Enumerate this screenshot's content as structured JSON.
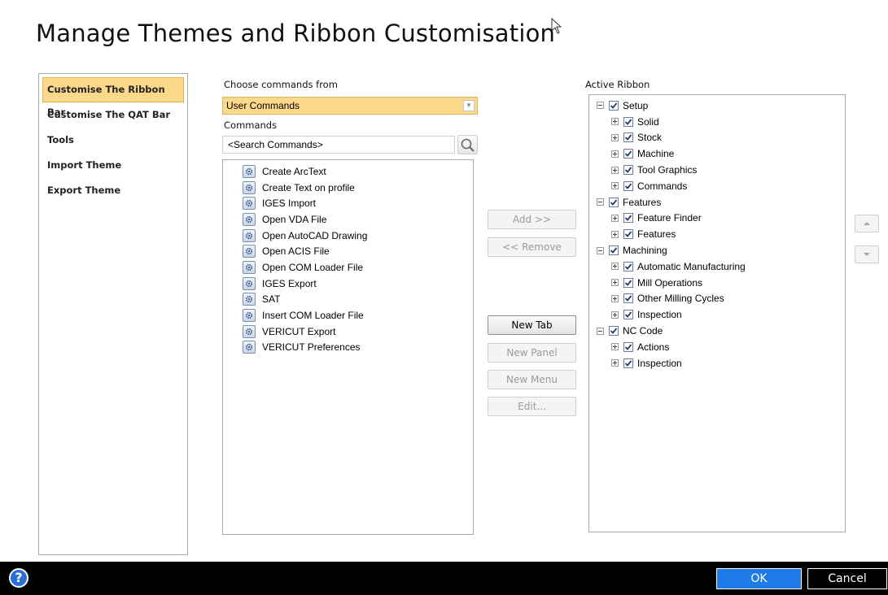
{
  "title": "Manage Themes and Ribbon Customisation",
  "nav": {
    "items": [
      {
        "label": "Customise The Ribbon Bar",
        "active": true
      },
      {
        "label": "Customise The QAT Bar",
        "active": false
      },
      {
        "label": "Tools",
        "active": false
      },
      {
        "label": "Import Theme",
        "active": false
      },
      {
        "label": "Export Theme",
        "active": false
      }
    ]
  },
  "commands_panel": {
    "choose_label": "Choose commands from",
    "selected_source": "User Commands",
    "commands_label": "Commands",
    "search_placeholder": "<Search Commands>",
    "items": [
      "Create ArcText",
      "Create Text on profile",
      "IGES Import",
      "Open VDA File",
      "Open AutoCAD Drawing",
      "Open ACIS File",
      "Open COM Loader File",
      "IGES Export",
      "SAT",
      "Insert COM Loader File",
      "VERICUT Export",
      "VERICUT Preferences"
    ]
  },
  "buttons": {
    "add": "Add >>",
    "remove": "<< Remove",
    "new_tab": "New Tab",
    "new_panel": "New Panel",
    "new_menu": "New Menu",
    "edit": "Edit..."
  },
  "active_ribbon": {
    "label": "Active Ribbon",
    "tree": [
      {
        "label": "Setup",
        "level": 0,
        "expanded": true,
        "checked": true
      },
      {
        "label": "Solid",
        "level": 1,
        "expanded": false,
        "checked": true
      },
      {
        "label": "Stock",
        "level": 1,
        "expanded": false,
        "checked": true
      },
      {
        "label": "Machine",
        "level": 1,
        "expanded": false,
        "checked": true
      },
      {
        "label": "Tool Graphics",
        "level": 1,
        "expanded": false,
        "checked": true
      },
      {
        "label": "Commands",
        "level": 1,
        "expanded": false,
        "checked": true
      },
      {
        "label": "Features",
        "level": 0,
        "expanded": true,
        "checked": true
      },
      {
        "label": "Feature Finder",
        "level": 1,
        "expanded": false,
        "checked": true
      },
      {
        "label": "Features",
        "level": 1,
        "expanded": false,
        "checked": true
      },
      {
        "label": "Machining",
        "level": 0,
        "expanded": true,
        "checked": true
      },
      {
        "label": "Automatic Manufacturing",
        "level": 1,
        "expanded": false,
        "checked": true
      },
      {
        "label": "Mill Operations",
        "level": 1,
        "expanded": false,
        "checked": true
      },
      {
        "label": "Other Milling Cycles",
        "level": 1,
        "expanded": false,
        "checked": true
      },
      {
        "label": "Inspection",
        "level": 1,
        "expanded": false,
        "checked": true
      },
      {
        "label": "NC Code",
        "level": 0,
        "expanded": true,
        "checked": true
      },
      {
        "label": "Actions",
        "level": 1,
        "expanded": false,
        "checked": true
      },
      {
        "label": "Inspection",
        "level": 1,
        "expanded": false,
        "checked": true
      }
    ]
  },
  "footer": {
    "help_glyph": "?",
    "ok": "OK",
    "cancel": "Cancel"
  },
  "colors": {
    "active_highlight": "#fcd98a",
    "ok_blue": "#1e7be8",
    "footer_bg": "#000000"
  }
}
